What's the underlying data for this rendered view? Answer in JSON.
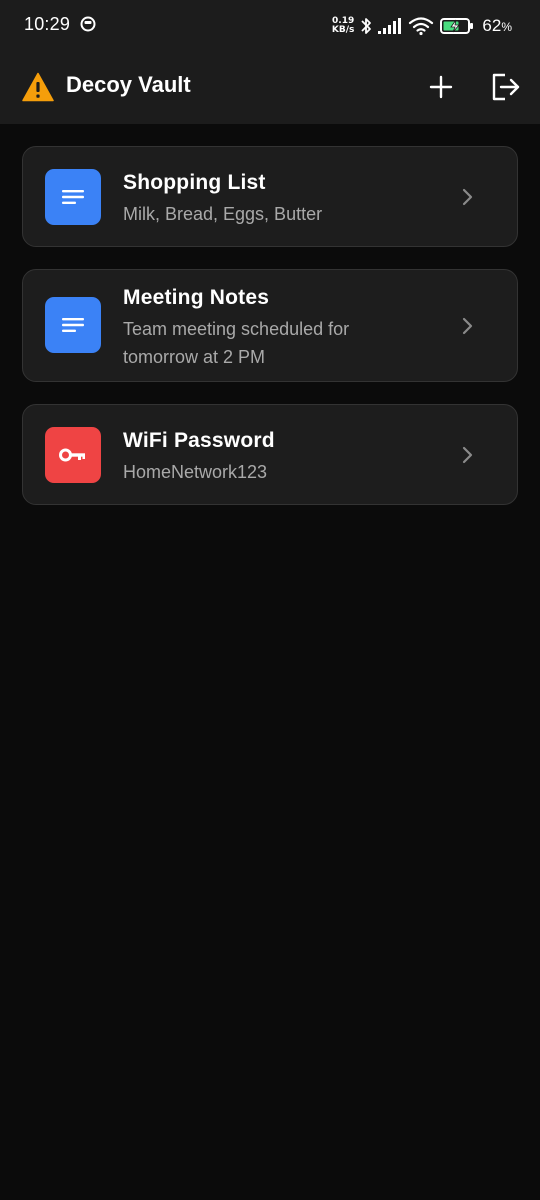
{
  "status_bar": {
    "time": "10:29",
    "net_speed_value": "0.19",
    "net_speed_unit": "KB/s",
    "battery_value": "62",
    "battery_unit": "%",
    "icons": [
      "notification-icon",
      "bluetooth-icon",
      "signal-icon",
      "wifi-icon",
      "battery-charging-icon"
    ]
  },
  "app_bar": {
    "title": "Decoy Vault",
    "leading_icon": "warning-icon",
    "actions": [
      "add-icon",
      "exit-icon"
    ],
    "warning_color": "#f59e0b"
  },
  "items": [
    {
      "title": "Shopping List",
      "subtitle": "Milk, Bread, Eggs, Butter",
      "icon": "note-lines-icon",
      "icon_color": "#3b82f6"
    },
    {
      "title": "Meeting Notes",
      "subtitle_line1": "Team meeting scheduled for",
      "subtitle_line2": "tomorrow at 2 PM",
      "icon": "note-lines-icon",
      "icon_color": "#3b82f6"
    },
    {
      "title": "WiFi Password",
      "subtitle": "HomeNetwork123",
      "icon": "key-icon",
      "icon_color": "#ef4444"
    }
  ],
  "colors": {
    "background": "#0b0b0b",
    "bar_background": "#1c1c1c",
    "card_background": "#1d1d1d",
    "card_border": "#333333",
    "subtitle_text": "#a9a9a9"
  }
}
